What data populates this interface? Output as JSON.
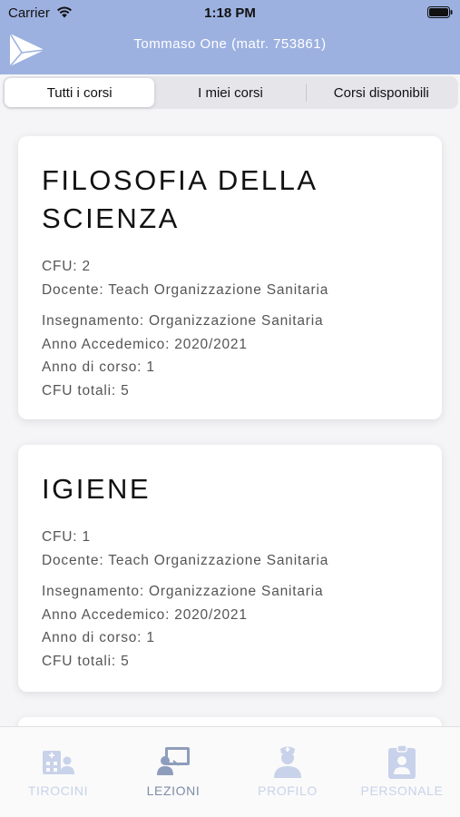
{
  "status_bar": {
    "carrier": "Carrier",
    "time": "1:18 PM"
  },
  "header": {
    "user": "Tommaso One (matr. 753861)"
  },
  "segments": [
    {
      "label": "Tutti i corsi",
      "selected": true
    },
    {
      "label": "I miei corsi",
      "selected": false
    },
    {
      "label": "Corsi disponibili",
      "selected": false
    }
  ],
  "courses": [
    {
      "title": "FILOSOFIA DELLA SCIENZA",
      "cfu": "CFU: 2",
      "docente": "Docente: Teach Organizzazione Sanitaria",
      "insegnamento": "Insegnamento: Organizzazione Sanitaria",
      "anno_accademico": "Anno Accedemico: 2020/2021",
      "anno_corso": "Anno di corso: 1",
      "cfu_totali": "CFU totali: 5"
    },
    {
      "title": "IGIENE",
      "cfu": "CFU: 1",
      "docente": "Docente: Teach Organizzazione Sanitaria",
      "insegnamento": "Insegnamento: Organizzazione Sanitaria",
      "anno_accademico": "Anno Accedemico: 2020/2021",
      "anno_corso": "Anno di corso: 1",
      "cfu_totali": "CFU totali: 5"
    }
  ],
  "tabs": [
    {
      "label": "TIROCINI",
      "icon": "hospital-icon",
      "active": false
    },
    {
      "label": "LEZIONI",
      "icon": "teacher-board-icon",
      "active": true
    },
    {
      "label": "PROFILO",
      "icon": "nurse-icon",
      "active": false
    },
    {
      "label": "PERSONALE",
      "icon": "id-badge-icon",
      "active": false
    }
  ],
  "colors": {
    "header": "#9db1e0",
    "tab_active": "#7d8ca8",
    "tab_inactive": "#c8d2ea"
  }
}
